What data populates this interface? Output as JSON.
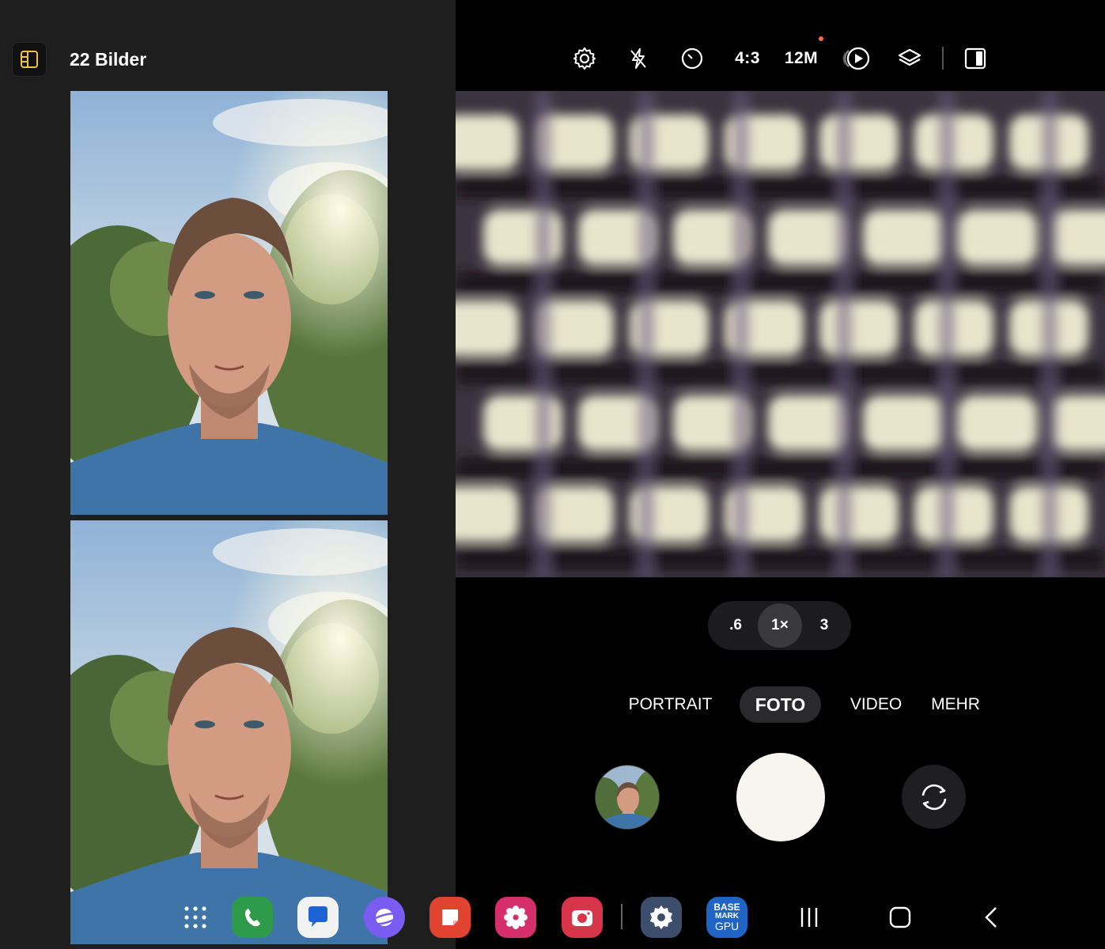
{
  "gallery": {
    "count_label": "22 Bilder",
    "panel_icon": "panel-toggle-icon"
  },
  "camera": {
    "top_bar": {
      "settings_icon": "gear-icon",
      "flash_icon": "flash-off-icon",
      "timer_icon": "timer-icon",
      "ratio": "4:3",
      "resolution": "12M",
      "motion_icon": "motion-photo-icon",
      "filter_icon": "layers-icon",
      "layout_icon": "split-view-icon"
    },
    "zoom": {
      "options": [
        ".6",
        "1×",
        "3"
      ],
      "selected": "1×"
    },
    "modes": {
      "portrait": "PORTRAIT",
      "foto": "FOTO",
      "video": "VIDEO",
      "mehr": "MEHR",
      "selected": "FOTO"
    },
    "shutter_icon": "shutter-button",
    "switch_icon": "switch-camera-icon"
  },
  "taskbar": {
    "apps": [
      {
        "name": "app-drawer-icon"
      },
      {
        "name": "phone-icon",
        "color": "#2e9b4a"
      },
      {
        "name": "messages-icon",
        "color": "#f2f2f2"
      },
      {
        "name": "internet-icon",
        "color": "#7a5cf2"
      },
      {
        "name": "notes-icon",
        "color": "#e0432f"
      },
      {
        "name": "gallery-icon",
        "color": "#d62d6b"
      },
      {
        "name": "camera-icon",
        "color": "#d8344a"
      },
      {
        "name": "settings-icon",
        "color": "#3d4e6c"
      },
      {
        "name": "basemark-gpu-icon",
        "color": "#1f63c4"
      }
    ],
    "basemark_label_1": "BASE",
    "basemark_label_2": "MARK",
    "basemark_label_3": "GPU"
  },
  "navigation": {
    "recents_icon": "recents-icon",
    "home_icon": "home-icon",
    "back_icon": "back-icon"
  },
  "colors": {
    "panel_bg": "#1e1e1e",
    "accent_yellow": "#f0c33c",
    "camera_bg": "#000000"
  }
}
